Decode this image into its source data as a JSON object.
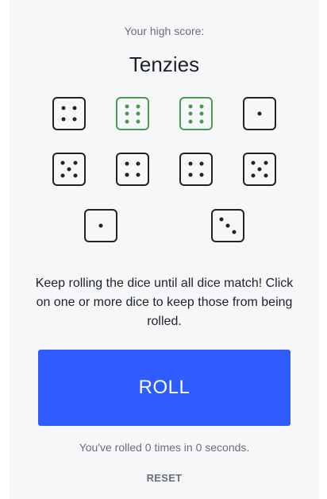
{
  "header": {
    "high_score_label": "Your high score:",
    "title": "Tenzies"
  },
  "dice": [
    {
      "value": 4,
      "held": false
    },
    {
      "value": 6,
      "held": true
    },
    {
      "value": 6,
      "held": true
    },
    {
      "value": 1,
      "held": false
    },
    {
      "value": 5,
      "held": false
    },
    {
      "value": 4,
      "held": false
    },
    {
      "value": 4,
      "held": false
    },
    {
      "value": 5,
      "held": false
    },
    {
      "value": 1,
      "held": false
    },
    {
      "value": 3,
      "held": false
    }
  ],
  "colors": {
    "held": "#4a9a55",
    "default": "#222222",
    "roll_button": "#2f5cff"
  },
  "instructions": "Keep rolling the dice until all dice match! Click on one or more dice to keep those from being rolled.",
  "roll_label": "ROLL",
  "stats_text": "You've rolled 0 times in 0 seconds.",
  "reset_label": "RESET"
}
